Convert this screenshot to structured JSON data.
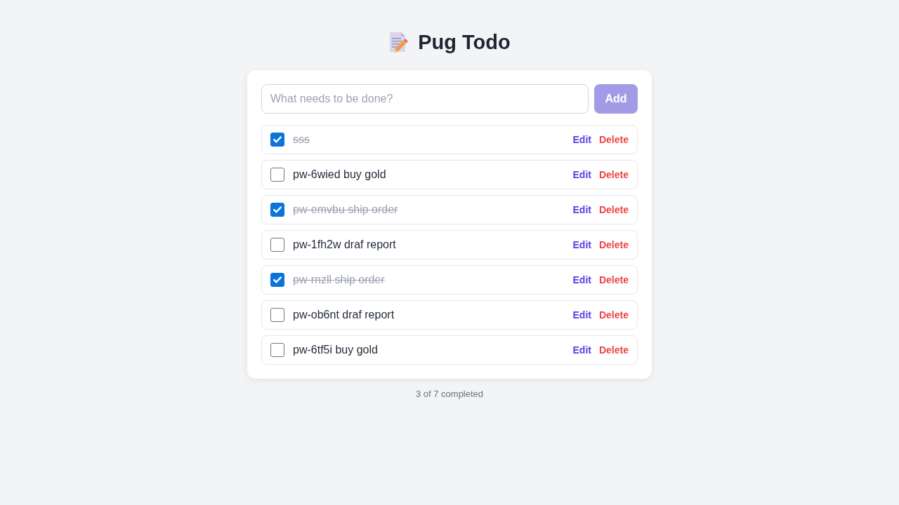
{
  "header": {
    "title": "Pug Todo"
  },
  "new_todo": {
    "placeholder": "What needs to be done?",
    "add_button": {
      "label": "Add",
      "disabled": true
    }
  },
  "todos": [
    {
      "text": "sss",
      "done": true,
      "edit_label": "Edit",
      "delete_label": "Delete"
    },
    {
      "text": "pw-6wied buy gold",
      "done": false,
      "edit_label": "Edit",
      "delete_label": "Delete"
    },
    {
      "text": "pw-emvbu ship order",
      "done": true,
      "edit_label": "Edit",
      "delete_label": "Delete"
    },
    {
      "text": "pw-1fh2w draf report",
      "done": false,
      "edit_label": "Edit",
      "delete_label": "Delete"
    },
    {
      "text": "pw-rnzll ship order",
      "done": true,
      "edit_label": "Edit",
      "delete_label": "Delete"
    },
    {
      "text": "pw-ob6nt draf report",
      "done": false,
      "edit_label": "Edit",
      "delete_label": "Delete"
    },
    {
      "text": "pw-6tf5i buy gold",
      "done": false,
      "edit_label": "Edit",
      "delete_label": "Delete"
    }
  ],
  "footer": {
    "summary": "3 of 7 completed"
  }
}
